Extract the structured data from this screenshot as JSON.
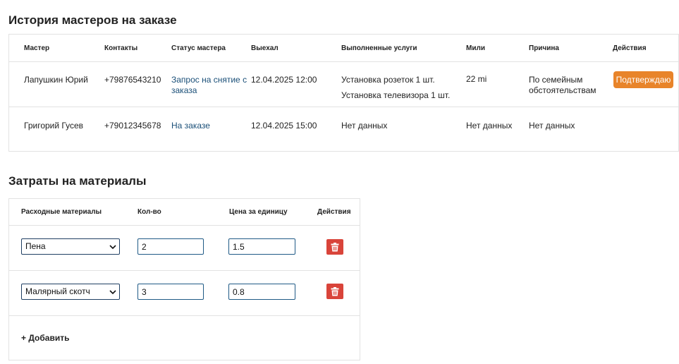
{
  "masters_section": {
    "title": "История мастеров на заказе",
    "headers": {
      "master": "Мастер",
      "contacts": "Контакты",
      "status": "Статус мастера",
      "departed": "Выехал",
      "services": "Выполненные услуги",
      "miles": "Мили",
      "reason": "Причина",
      "actions": "Действия"
    },
    "rows": [
      {
        "master": "Лапушкин Юрий",
        "contacts": "+79876543210",
        "status": "Запрос на снятие с заказа",
        "departed": "12.04.2025 12:00",
        "services": [
          "Установка розеток 1 шт.",
          "Установка телевизора 1 шт."
        ],
        "miles": "22 mi",
        "reason": "По семейным обстоятельствам",
        "action_label": "Подтверждаю"
      },
      {
        "master": "Григорий Гусев",
        "contacts": "+79012345678",
        "status": "На заказе",
        "departed": "12.04.2025 15:00",
        "services": [
          "Нет данных"
        ],
        "miles": "Нет данных",
        "reason": "Нет данных"
      }
    ]
  },
  "materials_section": {
    "title": "Затраты на материалы",
    "headers": {
      "material": "Расходные материалы",
      "qty": "Кол-во",
      "price": "Цена за единицу",
      "actions": "Действия"
    },
    "rows": [
      {
        "material": "Пена",
        "qty": "2",
        "price": "1.5"
      },
      {
        "material": "Малярный скотч",
        "qty": "3",
        "price": "0.8"
      }
    ],
    "add_label": "+ Добавить"
  },
  "colors": {
    "accent_orange": "#e8842a",
    "delete_red": "#d9443a",
    "link_blue": "#1a4f78"
  },
  "icons": {
    "delete": "trash-icon",
    "select": "chevron-down-icon"
  }
}
